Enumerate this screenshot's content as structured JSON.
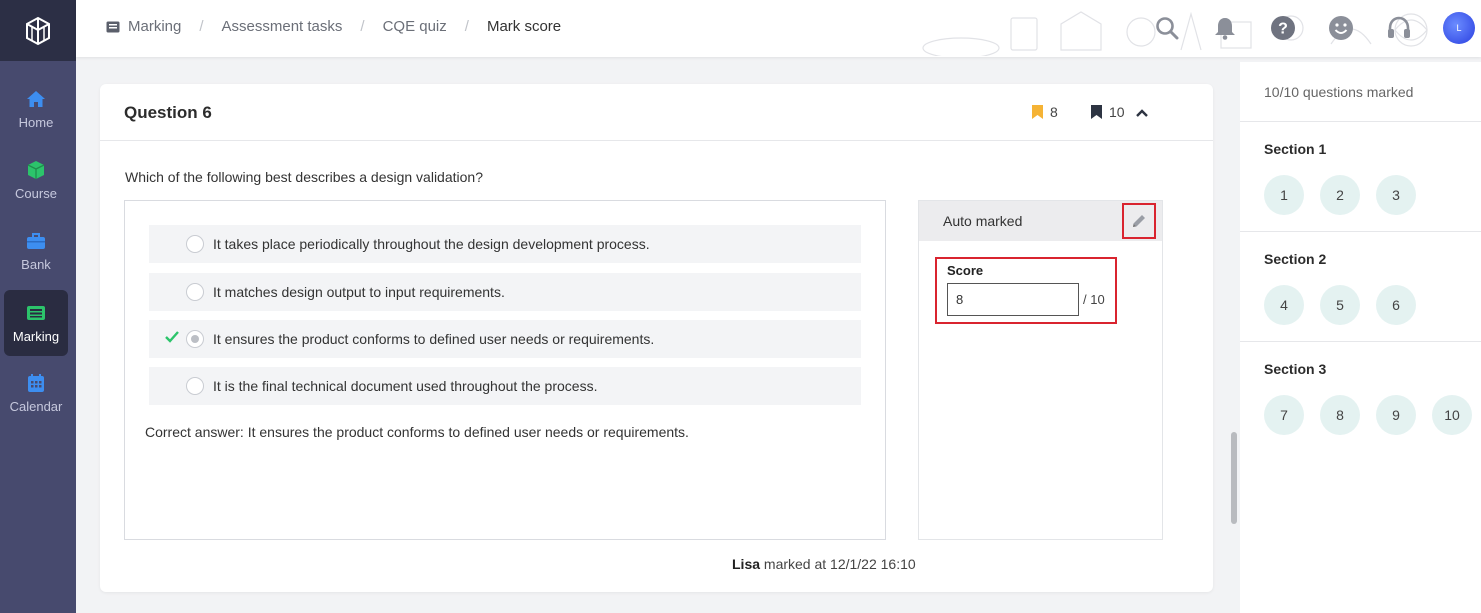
{
  "sidebar": {
    "items": [
      {
        "label": "Home",
        "icon": "home-icon"
      },
      {
        "label": "Course",
        "icon": "cube-icon"
      },
      {
        "label": "Bank",
        "icon": "toolbox-icon"
      },
      {
        "label": "Marking",
        "icon": "marking-icon",
        "active": true
      },
      {
        "label": "Calendar",
        "icon": "calendar-icon"
      }
    ]
  },
  "breadcrumb": [
    "Marking",
    "Assessment tasks",
    "CQE quiz",
    "Mark score"
  ],
  "header": {
    "avatar_initial": "L",
    "icons": [
      "search-icon",
      "bell-icon",
      "help-icon",
      "smiley-icon",
      "headset-icon"
    ]
  },
  "question": {
    "title": "Question 6",
    "bookmark_score": "8",
    "bookmark_total": "10",
    "text": "Which of the following best describes a design validation?",
    "options": [
      "It takes place periodically throughout the design development process.",
      "It matches design output to input requirements.",
      "It ensures the product conforms to defined user needs or requirements.",
      "It is the final technical document used throughout the process."
    ],
    "selected_index": 2,
    "correct_answer": "Correct answer: It ensures the product conforms to defined user needs or requirements."
  },
  "marking": {
    "header": "Auto marked",
    "score_label": "Score",
    "score_value": "8",
    "score_max": "/ 10"
  },
  "footer": {
    "marker": "Lisa",
    "marked_at": " marked at 12/1/22 16:10"
  },
  "right_panel": {
    "marked_count": "10/10 questions marked",
    "sections": [
      {
        "title": "Section 1",
        "questions": [
          "1",
          "2",
          "3"
        ]
      },
      {
        "title": "Section 2",
        "questions": [
          "4",
          "5",
          "6"
        ]
      },
      {
        "title": "Section 3",
        "questions": [
          "7",
          "8",
          "9",
          "10"
        ]
      }
    ]
  },
  "colors": {
    "sidebar": "#474a6e",
    "sidebar_active": "#2a2c41",
    "icon_blue": "#3d8ef0",
    "icon_green": "#2cc46b",
    "bookmark_orange": "#f5b335",
    "bookmark_dark": "#2d3442",
    "highlight_red": "#d9242f",
    "qbtn_bg": "#e4f2f1"
  }
}
